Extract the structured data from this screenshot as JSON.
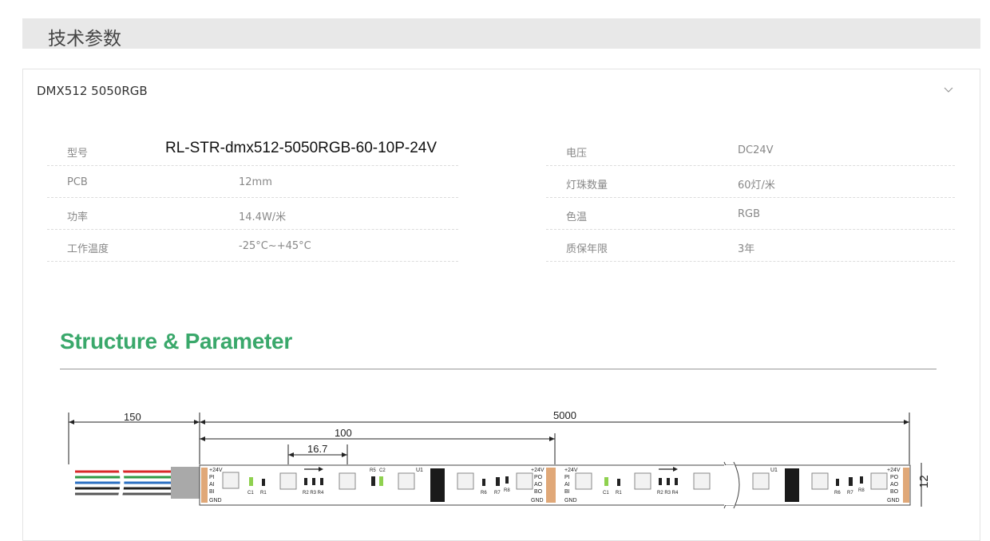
{
  "section": {
    "title": "技术参数"
  },
  "panel": {
    "title": "DMX512 5050RGB"
  },
  "specs": {
    "left": [
      {
        "label": "型号",
        "value": "RL-STR-dmx512-5050RGB-60-10P-24V"
      },
      {
        "label": "PCB",
        "value": "12mm"
      },
      {
        "label": "功率",
        "value": "14.4W/米"
      },
      {
        "label": "工作温度",
        "value": "-25°C~+45°C"
      }
    ],
    "right": [
      {
        "label": "电压",
        "value": "DC24V"
      },
      {
        "label": "灯珠数量",
        "value": "60灯/米"
      },
      {
        "label": "色温",
        "value": "RGB"
      },
      {
        "label": "质保年限",
        "value": "3年"
      }
    ]
  },
  "structure": {
    "title": "Structure & Parameter",
    "dims": {
      "lead": "150",
      "segment": "100",
      "total": "5000",
      "pitch": "16.7",
      "width": "12"
    },
    "pins": [
      "+24V",
      "PI",
      "AI",
      "BI",
      "GND"
    ],
    "pins_out": [
      "+24V",
      "PO",
      "AO",
      "BO",
      "GND"
    ],
    "labels": {
      "c1": "C1",
      "r1": "R1",
      "r234": "R2 R3 R4",
      "r5": "R5",
      "c2": "C2",
      "u1": "U1",
      "r6": "R6",
      "r7": "R7",
      "r8": "R8"
    },
    "colors": {
      "accent": "#3aa86b",
      "wire_red": "#d8282a",
      "wire_green": "#2f9a45",
      "wire_blue": "#2a6fc2",
      "pad": "#e0a878"
    }
  }
}
